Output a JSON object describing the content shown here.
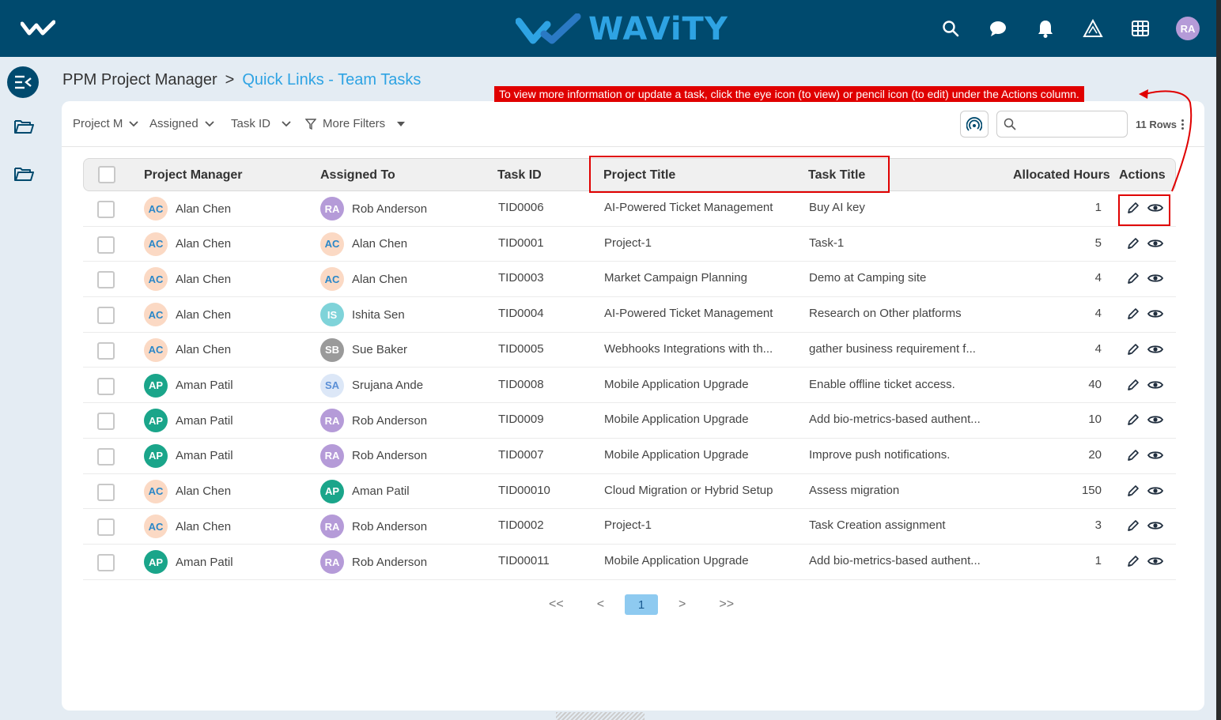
{
  "brand": {
    "name": "WAViTY"
  },
  "topbar": {
    "user_initials": "RA"
  },
  "breadcrumb": {
    "root": "PPM Project Manager",
    "separator": ">",
    "current": "Quick Links - Team Tasks"
  },
  "annotation": {
    "text": "To view more information or update a task, click the eye icon (to view) or pencil icon (to edit) under the Actions column."
  },
  "filters": {
    "project_manager": "Project M",
    "assigned": "Assigned",
    "task_id": "Task ID",
    "more_filters": "More Filters",
    "search_placeholder": "",
    "rows_label": "11 Rows"
  },
  "columns": {
    "project_manager": "Project Manager",
    "assigned_to": "Assigned To",
    "task_id": "Task ID",
    "project_title": "Project Title",
    "task_title": "Task Title",
    "allocated_hours": "Allocated Hours",
    "actions": "Actions"
  },
  "avatar_colors": {
    "AC": {
      "bg": "#fbd9c4",
      "fg": "#2a87c8"
    },
    "AP": {
      "bg": "#1aa58a",
      "fg": "#ffffff"
    },
    "RA": {
      "bg": "#b59bd8",
      "fg": "#ffffff"
    },
    "IS": {
      "bg": "#7fd3d9",
      "fg": "#ffffff"
    },
    "SB": {
      "bg": "#9a9a9a",
      "fg": "#ffffff"
    },
    "SA": {
      "bg": "#dce7f7",
      "fg": "#5b8fd6"
    }
  },
  "rows": [
    {
      "pm_initials": "AC",
      "pm": "Alan Chen",
      "as_initials": "RA",
      "assigned": "Rob Anderson",
      "task_id": "TID0006",
      "project": "AI-Powered Ticket Management",
      "task": "Buy AI key",
      "hours": "1"
    },
    {
      "pm_initials": "AC",
      "pm": "Alan Chen",
      "as_initials": "AC",
      "assigned": "Alan Chen",
      "task_id": "TID0001",
      "project": "Project-1",
      "task": "Task-1",
      "hours": "5"
    },
    {
      "pm_initials": "AC",
      "pm": "Alan Chen",
      "as_initials": "AC",
      "assigned": "Alan Chen",
      "task_id": "TID0003",
      "project": "Market Campaign Planning",
      "task": "Demo at Camping site",
      "hours": "4"
    },
    {
      "pm_initials": "AC",
      "pm": "Alan Chen",
      "as_initials": "IS",
      "assigned": "Ishita Sen",
      "task_id": "TID0004",
      "project": "AI-Powered Ticket Management",
      "task": "Research on Other platforms",
      "hours": "4"
    },
    {
      "pm_initials": "AC",
      "pm": "Alan Chen",
      "as_initials": "SB",
      "assigned": "Sue Baker",
      "task_id": "TID0005",
      "project": "Webhooks Integrations with th...",
      "task": "gather business requirement f...",
      "hours": "4"
    },
    {
      "pm_initials": "AP",
      "pm": "Aman Patil",
      "as_initials": "SA",
      "assigned": "Srujana Ande",
      "task_id": "TID0008",
      "project": "Mobile Application Upgrade",
      "task": "Enable offline ticket access.",
      "hours": "40"
    },
    {
      "pm_initials": "AP",
      "pm": "Aman Patil",
      "as_initials": "RA",
      "assigned": "Rob Anderson",
      "task_id": "TID0009",
      "project": "Mobile Application Upgrade",
      "task": "Add bio-metrics-based authent...",
      "hours": "10"
    },
    {
      "pm_initials": "AP",
      "pm": "Aman Patil",
      "as_initials": "RA",
      "assigned": "Rob Anderson",
      "task_id": "TID0007",
      "project": "Mobile Application Upgrade",
      "task": "Improve push notifications.",
      "hours": "20"
    },
    {
      "pm_initials": "AC",
      "pm": "Alan Chen",
      "as_initials": "AP",
      "assigned": "Aman Patil",
      "task_id": "TID00010",
      "project": "Cloud Migration or Hybrid Setup",
      "task": "Assess migration",
      "hours": "150"
    },
    {
      "pm_initials": "AC",
      "pm": "Alan Chen",
      "as_initials": "RA",
      "assigned": "Rob Anderson",
      "task_id": "TID0002",
      "project": "Project-1",
      "task": "Task Creation assignment",
      "hours": "3"
    },
    {
      "pm_initials": "AP",
      "pm": "Aman Patil",
      "as_initials": "RA",
      "assigned": "Rob Anderson",
      "task_id": "TID00011",
      "project": "Mobile Application Upgrade",
      "task": "Add bio-metrics-based authent...",
      "hours": "1"
    }
  ],
  "pagination": {
    "first": "<<",
    "prev": "<",
    "current": "1",
    "next": ">",
    "last": ">>"
  }
}
